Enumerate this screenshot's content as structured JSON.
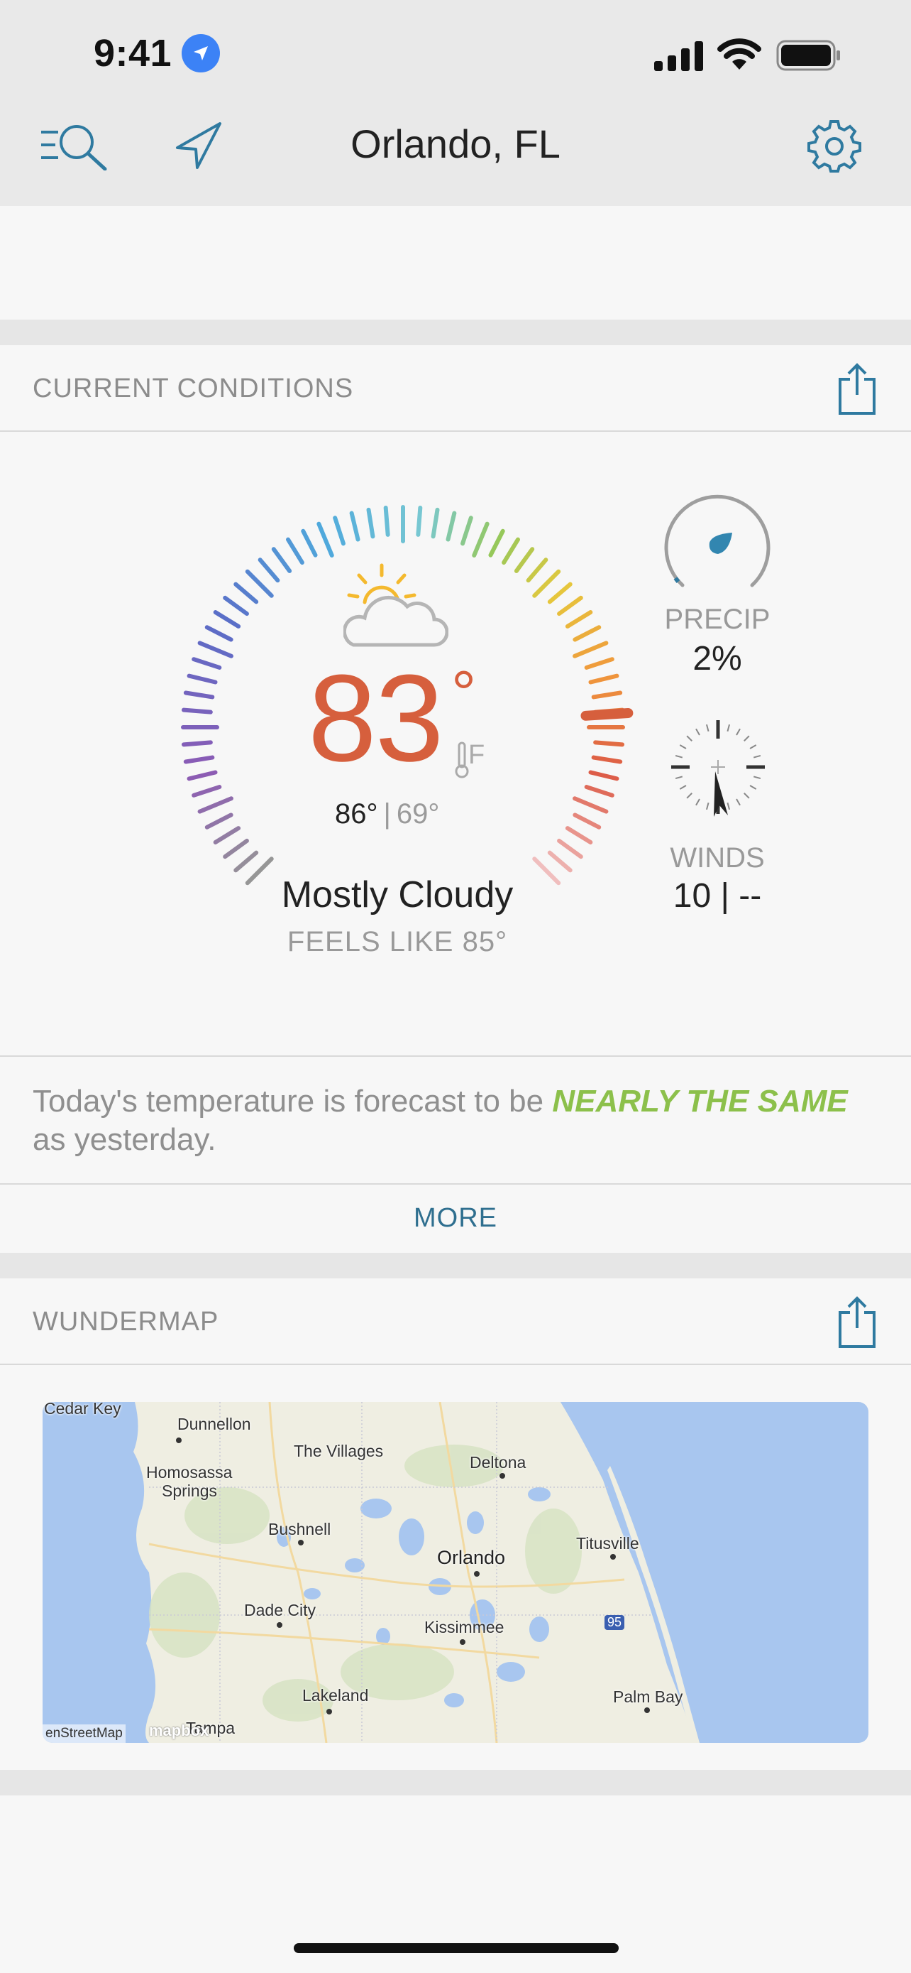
{
  "status_bar": {
    "time": "9:41"
  },
  "nav": {
    "title": "Orlando, FL"
  },
  "current_conditions": {
    "section_title": "CURRENT CONDITIONS",
    "temperature": "83",
    "degree_symbol": "°",
    "unit": "F",
    "high": "86°",
    "separator": "|",
    "low": "69°",
    "condition": "Mostly Cloudy",
    "feels_like": "FEELS LIKE 85°",
    "precip_label": "PRECIP",
    "precip_value": "2%",
    "winds_label": "WINDS",
    "winds_value": "10 | --",
    "weather_icon": "partly-cloudy-day-icon"
  },
  "forecast_note": {
    "prefix": "Today's temperature is forecast to be ",
    "emphasis": "NEARLY THE SAME",
    "suffix": " as yesterday.",
    "emphasis_color": "#8cc04b"
  },
  "more": {
    "label": "MORE"
  },
  "wundermap": {
    "section_title": "WUNDERMAP",
    "places": {
      "cedar_key": "Cedar Key",
      "dunnellon": "Dunnellon",
      "the_villages": "The Villages",
      "deltona": "Deltona",
      "homosassa": "Homosassa",
      "springs": "Springs",
      "bushnell": "Bushnell",
      "titusville": "Titusville",
      "orlando": "Orlando",
      "dade_city": "Dade City",
      "kissimmee": "Kissimmee",
      "highway": "95",
      "lakeland": "Lakeland",
      "palm_bay": "Palm Bay",
      "tampa": "Tampa"
    },
    "attribution": "enStreetMap",
    "logo": "mapbox"
  },
  "colors": {
    "accent": "#2f7aa0",
    "temperature": "#d65f3d",
    "background": "#f7f7f7",
    "header": "#e9e9e9"
  }
}
